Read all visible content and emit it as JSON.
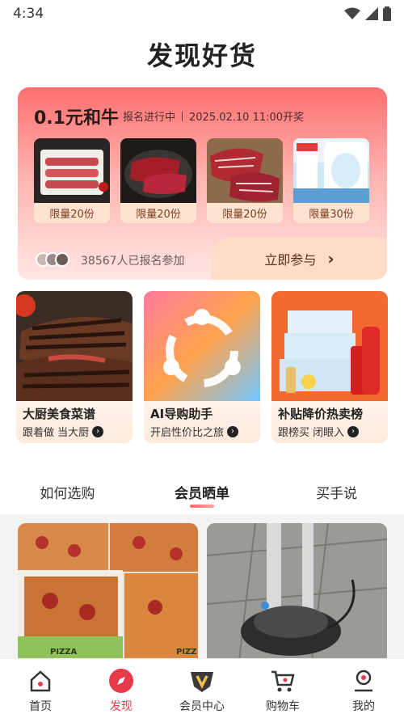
{
  "status_bar": {
    "time": "4:34"
  },
  "header": {
    "title": "发现好货"
  },
  "promo": {
    "title": "0.1元和牛",
    "status": "报名进行中",
    "time": "2025.02.10 11:00开奖",
    "items": [
      {
        "label": "限量20份"
      },
      {
        "label": "限量20份"
      },
      {
        "label": "限量20份"
      },
      {
        "label": "限量30份"
      }
    ],
    "participants": "38567人已报名参加",
    "join_label": "立即参与",
    "join_arrow": "›"
  },
  "features": [
    {
      "title": "大厨美食菜谱",
      "subtitle": "跟着做 当大厨"
    },
    {
      "title": "AI导购助手",
      "subtitle": "开启性价比之旅"
    },
    {
      "title": "补贴降价热卖榜",
      "subtitle": "跟榜买 闭眼入"
    }
  ],
  "tabs": [
    {
      "label": "如何选购",
      "active": false
    },
    {
      "label": "会员晒单",
      "active": true
    },
    {
      "label": "买手说",
      "active": false
    }
  ],
  "bottom_nav": [
    {
      "label": "首页",
      "icon": "home-icon",
      "active": false
    },
    {
      "label": "发现",
      "icon": "compass-icon",
      "active": true
    },
    {
      "label": "会员中心",
      "icon": "member-v-icon",
      "active": false
    },
    {
      "label": "购物车",
      "icon": "cart-icon",
      "active": false
    },
    {
      "label": "我的",
      "icon": "profile-icon",
      "active": false
    }
  ],
  "colors": {
    "accent": "#e8394b",
    "promo_top": "#ff6f6f",
    "join_button": "#ffdcc7"
  }
}
